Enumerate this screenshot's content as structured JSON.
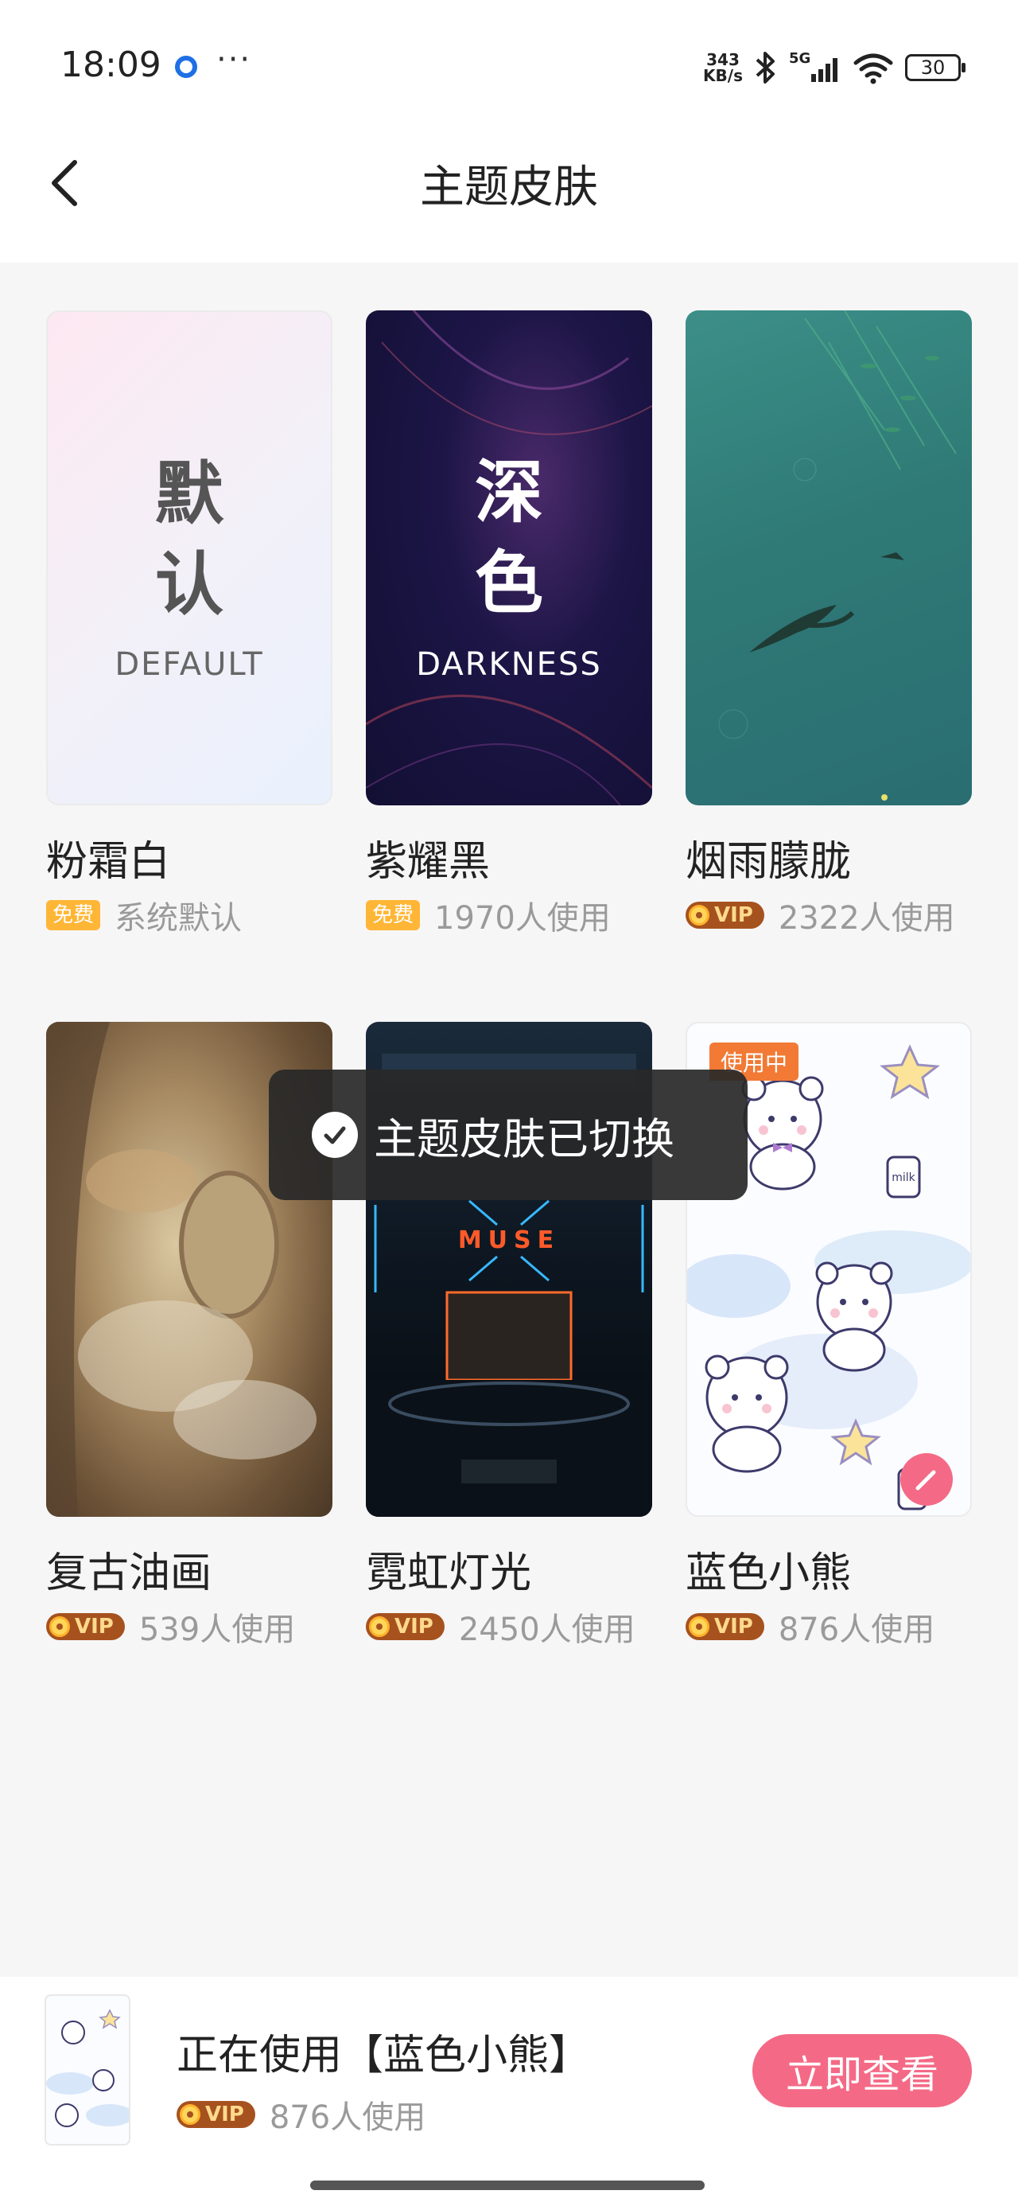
{
  "status_bar": {
    "time": "18:09",
    "more": "···",
    "net_speed_value": "343",
    "net_speed_unit": "KB/s",
    "network": "5G",
    "battery": "30"
  },
  "header": {
    "title": "主题皮肤"
  },
  "themes": [
    {
      "name": "粉霜白",
      "badge": "免费",
      "meta": "系统默认",
      "thumb_big": [
        "默",
        "认"
      ],
      "thumb_small": "DEFAULT"
    },
    {
      "name": "紫耀黑",
      "badge": "免费",
      "meta": "1970人使用",
      "thumb_big": [
        "深",
        "色"
      ],
      "thumb_small": "DARKNESS"
    },
    {
      "name": "烟雨朦胧",
      "badge": "VIP",
      "meta": "2322人使用"
    },
    {
      "name": "复古油画",
      "badge": "VIP",
      "meta": "539人使用"
    },
    {
      "name": "霓虹灯光",
      "badge": "VIP",
      "meta": "2450人使用",
      "sign": "MUSE"
    },
    {
      "name": "蓝色小熊",
      "badge": "VIP",
      "meta": "876人使用",
      "tag": "使用中",
      "jar_label": "milk"
    }
  ],
  "toast": {
    "text": "主题皮肤已切换"
  },
  "bottom": {
    "current_title": "正在使用【蓝色小熊】",
    "badge": "VIP",
    "meta": "876人使用",
    "button_label": "立即查看"
  },
  "colors": {
    "accent": "#f46a86",
    "free_badge": "#ffb636",
    "vip_badge": "#a6521f",
    "using_tag": "#f27a35"
  },
  "icons": [
    "back-arrow-icon",
    "bluetooth-icon",
    "signal-icon",
    "wifi-icon",
    "battery-icon",
    "check-icon",
    "edit-icon"
  ]
}
